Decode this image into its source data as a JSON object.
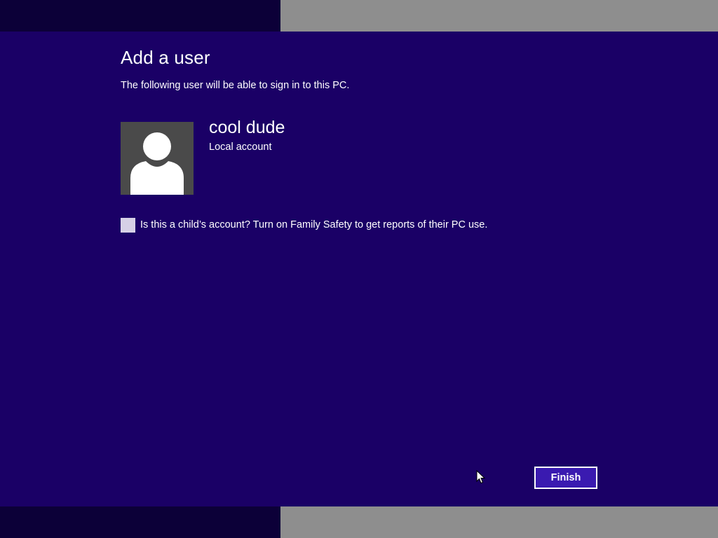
{
  "page": {
    "title": "Add a user",
    "subtitle": "The following user will be able to sign in to this PC."
  },
  "user": {
    "name": "cool dude",
    "account_type": "Local account",
    "avatar_icon": "user-silhouette-icon"
  },
  "child_option": {
    "label": "Is this a child’s account? Turn on Family Safety to get reports of their PC use.",
    "checked": false
  },
  "actions": {
    "finish_label": "Finish"
  },
  "colors": {
    "background": "#1a0066",
    "band_dark": "#0c0038",
    "band_light": "#8e8e8e",
    "avatar_bg": "#4a4a4a",
    "button_bg": "#3a1ab0",
    "text": "#ffffff"
  }
}
